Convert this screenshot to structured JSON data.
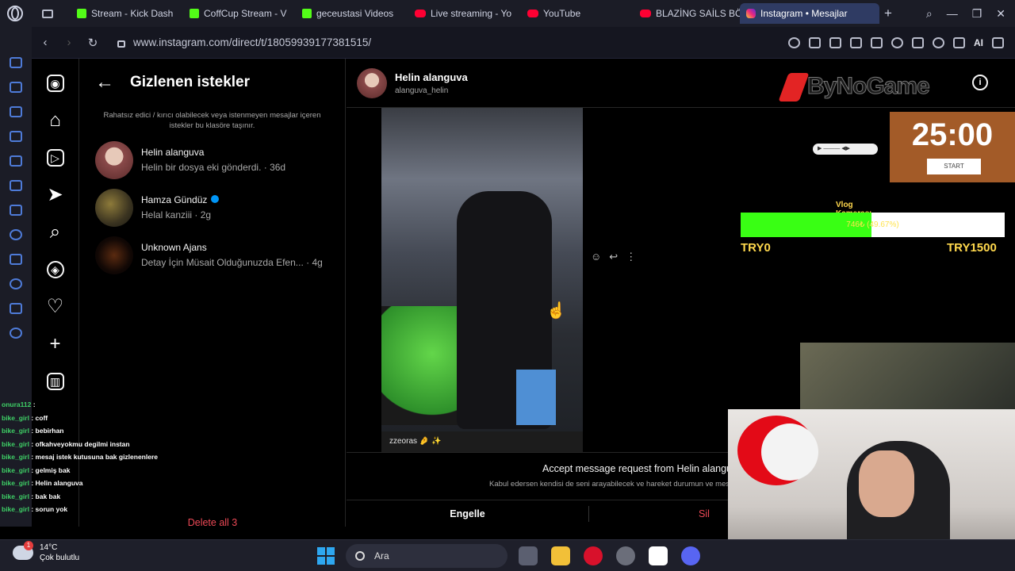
{
  "browser": {
    "tabs": [
      {
        "label": "Stream - Kick Dash",
        "favicon": "kick-icon"
      },
      {
        "label": "CoffCup Stream - V",
        "favicon": "kick-icon"
      },
      {
        "label": "geceustasi Videos",
        "favicon": "kick-icon"
      },
      {
        "label": "Live streaming - Yo",
        "favicon": "youtube-icon"
      },
      {
        "label": "YouTube",
        "favicon": "youtube-icon"
      },
      {
        "label": "BLAZİNG SAİLS BÖ",
        "favicon": "youtube-icon"
      },
      {
        "label": "Instagram • Mesajlar",
        "favicon": "instagram-icon",
        "active": true
      }
    ],
    "url": "www.instagram.com/direct/t/18059939177381515/",
    "ai_label": "AI"
  },
  "requests_panel": {
    "title": "Gizlenen istekler",
    "description": "Rahatsız edici / kırıcı olabilecek veya istenmeyen mesajlar içeren istekler bu klasöre taşınır.",
    "items": [
      {
        "name": "Helin alanguva",
        "preview": "Helin bir dosya eki gönderdi. · 36d",
        "verified": false
      },
      {
        "name": "Hamza Gündüz",
        "preview": "Helal kanziii · 2g",
        "verified": true
      },
      {
        "name": "Unknown Ajans",
        "preview": "Detay İçin Müsait Olduğunuzda Efen... · 4g",
        "verified": false
      }
    ],
    "delete_all": "Delete all 3"
  },
  "chat": {
    "name": "Helin alanguva",
    "username": "alanguva_helin",
    "video_caption": "zzeoras 🤌 ✨",
    "accept_title": "Accept message request from Helin alanguva",
    "accept_desc": "Kabul edersen kendisi de seni arayabilecek ve hareket durumun ve mesajl",
    "block_label": "Engelle",
    "delete_label": "Sil"
  },
  "stream_overlay": {
    "brand": "ByNoGame",
    "timer": "25:00",
    "timer_button": "START",
    "goal_title": "Vlog Kamerası ✨",
    "goal_progress": 0.4967,
    "goal_text": "746₺ (49.67%)",
    "goal_min": "TRY0",
    "goal_max": "TRY1500",
    "chat": [
      {
        "user": "onura112",
        "text": ""
      },
      {
        "user": "bike_girl",
        "text": "coff"
      },
      {
        "user": "bike_girl",
        "text": "bebirhan"
      },
      {
        "user": "bike_girl",
        "text": "ofkahveyokmu degilmi instan"
      },
      {
        "user": "bike_girl",
        "text": "mesaj istek kutusuna bak gizlenenlere"
      },
      {
        "user": "bike_girl",
        "text": "gelmiş bak"
      },
      {
        "user": "bike_girl",
        "text": "Helin alanguva"
      },
      {
        "user": "bike_girl",
        "text": "bak bak"
      },
      {
        "user": "bike_girl",
        "text": "sorun yok"
      }
    ]
  },
  "taskbar": {
    "weather_temp": "14°C",
    "weather_desc": "Çok bulutlu",
    "weather_badge": "1",
    "search_placeholder": "Ara"
  },
  "colors": {
    "accent_ig": "#0095f6",
    "danger": "#ed4956",
    "goal_fill": "#39ff14",
    "timer_bg": "#a35b28"
  }
}
